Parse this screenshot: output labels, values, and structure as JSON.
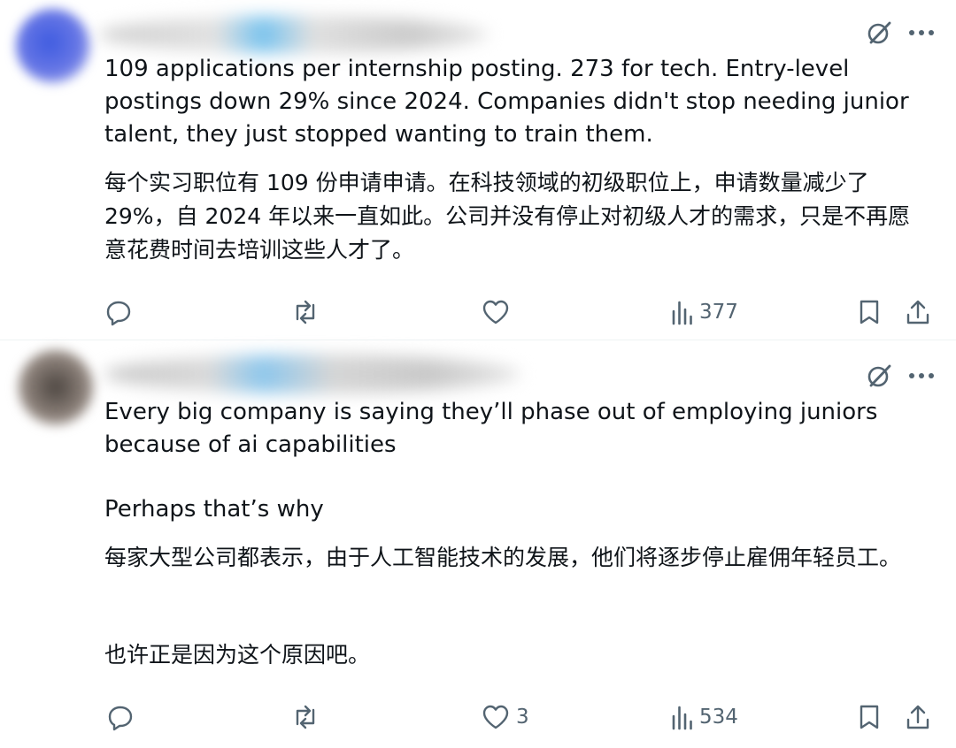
{
  "posts": [
    {
      "text_en": "109 applications per internship posting. 273 for tech. Entry-level postings down 29% since 2024. Companies didn't stop needing junior talent, they just stopped wanting to train them.",
      "text_zh": "每个实习职位有 109 份申请申请。在科技领域的初级职位上，申请数量减少了 29%，自 2024 年以来一直如此。公司并没有停止对初级人才的需求，只是不再愿意花费时间去培训这些人才了。",
      "likes": "",
      "views": "377",
      "icons": [
        "grok-icon",
        "more-icon",
        "reply-icon",
        "repost-icon",
        "like-icon",
        "views-icon",
        "bookmark-icon",
        "share-icon"
      ]
    },
    {
      "text_en": "Every big company is saying they’ll phase out of employing juniors because of ai capabilities",
      "text_en2": "Perhaps that’s why",
      "text_zh": "每家大型公司都表示，由于人工智能技术的发展，他们将逐步停止雇佣年轻员工。",
      "text_zh2": "也许正是因为这个原因吧。",
      "likes": "3",
      "views": "534",
      "icons": [
        "grok-icon",
        "more-icon",
        "reply-icon",
        "repost-icon",
        "like-icon",
        "views-icon",
        "bookmark-icon",
        "share-icon"
      ]
    }
  ],
  "colors": {
    "text": "#0f1419",
    "muted": "#536471",
    "divider": "#eff3f4"
  }
}
